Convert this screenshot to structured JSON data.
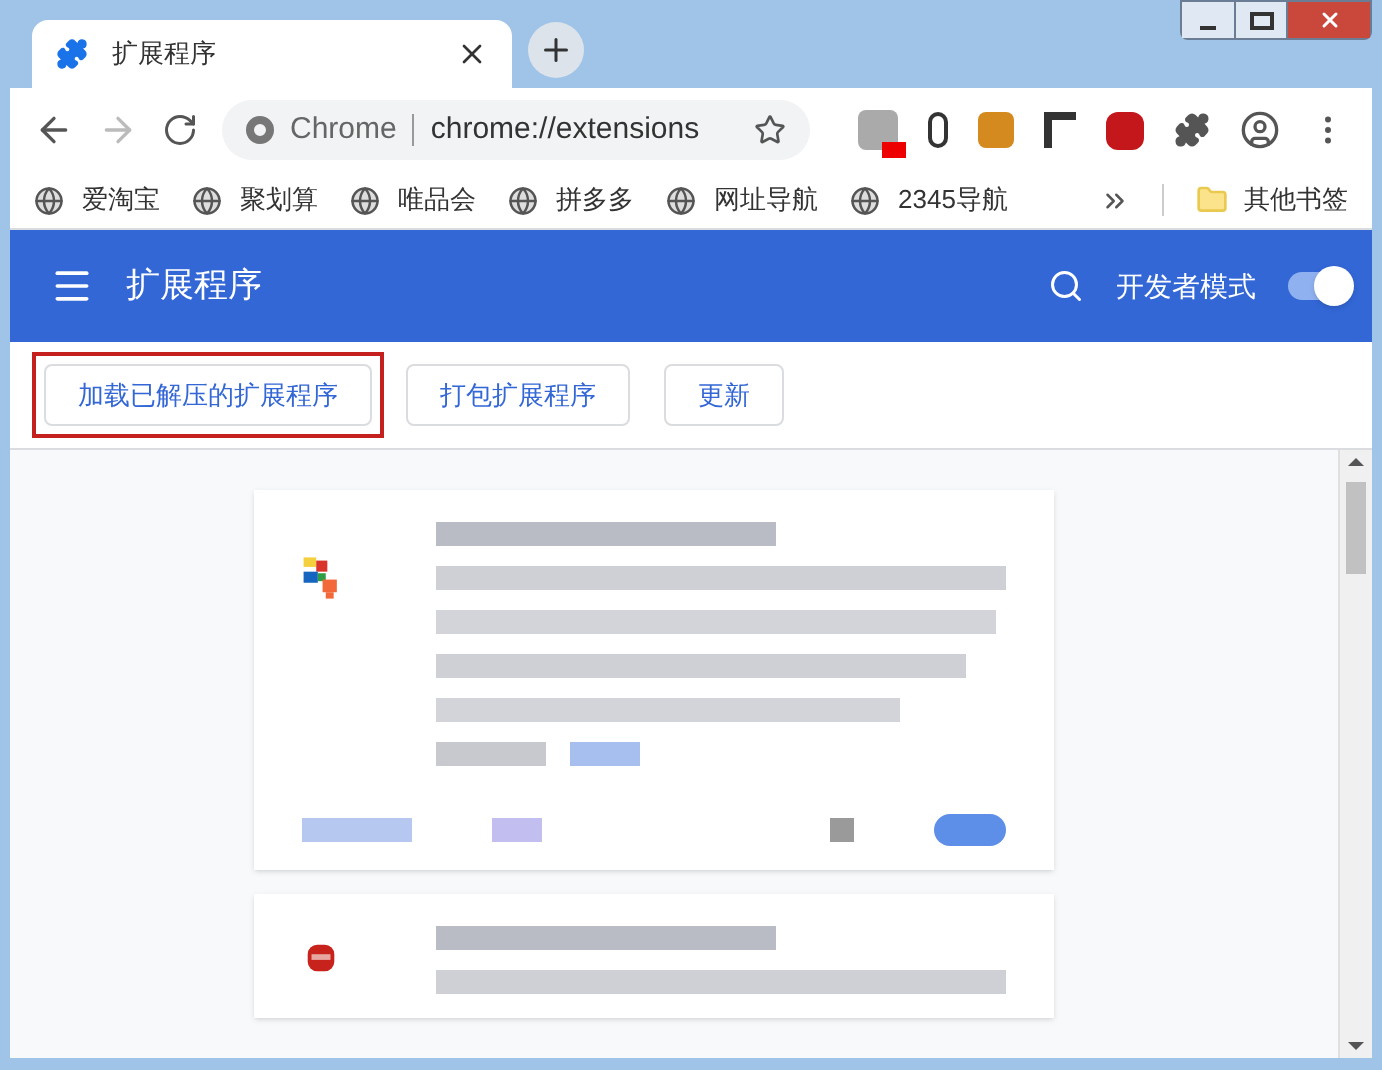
{
  "tab": {
    "title": "扩展程序"
  },
  "address_bar": {
    "site": "Chrome",
    "url": "chrome://extensions"
  },
  "bookmarks": [
    "爱淘宝",
    "聚划算",
    "唯品会",
    "拼多多",
    "网址导航",
    "2345导航"
  ],
  "other_bookmarks": "其他书签",
  "header": {
    "title": "扩展程序",
    "developer_mode_label": "开发者模式",
    "developer_mode_on": true
  },
  "buttons": [
    {
      "label": "加载已解压的扩展程序",
      "highlighted": true
    },
    {
      "label": "打包扩展程序",
      "highlighted": false
    },
    {
      "label": "更新",
      "highlighted": false
    }
  ]
}
